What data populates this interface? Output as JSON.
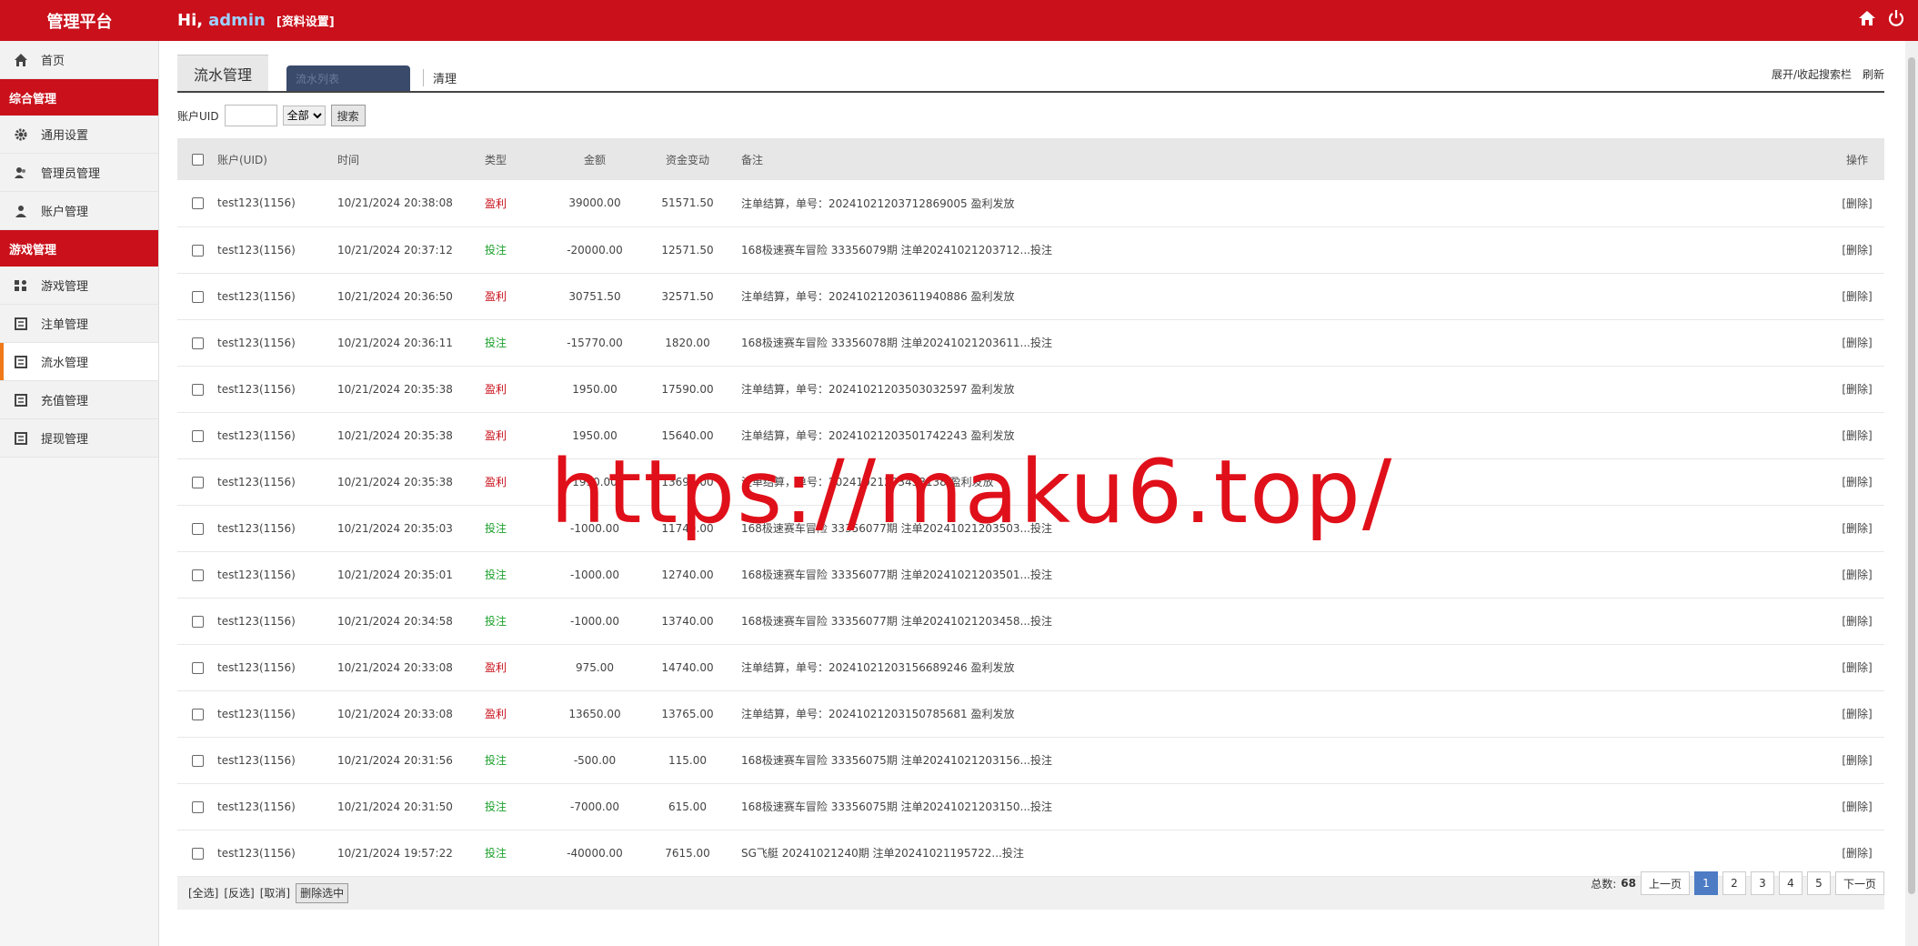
{
  "app": {
    "title": "管理平台",
    "greeting": "Hi,",
    "user": "admin",
    "profile_link": "[资料设置]"
  },
  "sidebar": {
    "home": "首页",
    "group1": "综合管理",
    "general_settings": "通用设置",
    "admin_manage": "管理员管理",
    "account_manage": "账户管理",
    "group2": "游戏管理",
    "game_manage": "游戏管理",
    "bet_manage": "注单管理",
    "flow_manage": "流水管理",
    "recharge_manage": "充值管理",
    "withdraw_manage": "提现管理"
  },
  "tabs": {
    "active": "流水管理",
    "input_placeholder": "流水列表",
    "clear": "清理",
    "toggle_search": "展开/收起搜索栏",
    "refresh": "刷新"
  },
  "search": {
    "label": "账户UID",
    "select_value": "全部",
    "button": "搜索"
  },
  "table": {
    "headers": {
      "account": "账户(UID)",
      "time": "时间",
      "type": "类型",
      "amount": "金额",
      "change": "资金变动",
      "note": "备注",
      "action": "操作"
    },
    "rows": [
      {
        "account": "test123(1156)",
        "time": "10/21/2024 20:38:08",
        "type": "盈利",
        "amount": "39000.00",
        "change": "51571.50",
        "note": "注单结算，单号：20241021203712869005 盈利发放",
        "action": "[删除]"
      },
      {
        "account": "test123(1156)",
        "time": "10/21/2024 20:37:12",
        "type": "投注",
        "amount": "-20000.00",
        "change": "12571.50",
        "note": "168极速赛车冒险 33356079期 注单20241021203712...投注",
        "action": "[删除]"
      },
      {
        "account": "test123(1156)",
        "time": "10/21/2024 20:36:50",
        "type": "盈利",
        "amount": "30751.50",
        "change": "32571.50",
        "note": "注单结算，单号：20241021203611940886 盈利发放",
        "action": "[删除]"
      },
      {
        "account": "test123(1156)",
        "time": "10/21/2024 20:36:11",
        "type": "投注",
        "amount": "-15770.00",
        "change": "1820.00",
        "note": "168极速赛车冒险 33356078期 注单20241021203611...投注",
        "action": "[删除]"
      },
      {
        "account": "test123(1156)",
        "time": "10/21/2024 20:35:38",
        "type": "盈利",
        "amount": "1950.00",
        "change": "17590.00",
        "note": "注单结算，单号：20241021203503032597 盈利发放",
        "action": "[删除]"
      },
      {
        "account": "test123(1156)",
        "time": "10/21/2024 20:35:38",
        "type": "盈利",
        "amount": "1950.00",
        "change": "15640.00",
        "note": "注单结算，单号：20241021203501742243 盈利发放",
        "action": "[删除]"
      },
      {
        "account": "test123(1156)",
        "time": "10/21/2024 20:35:38",
        "type": "盈利",
        "amount": "1950.00",
        "change": "13690.00",
        "note": "注单结算，单号：20241021203458138 盈利发放",
        "action": "[删除]"
      },
      {
        "account": "test123(1156)",
        "time": "10/21/2024 20:35:03",
        "type": "投注",
        "amount": "-1000.00",
        "change": "11740.00",
        "note": "168极速赛车冒险 33356077期 注单20241021203503...投注",
        "action": "[删除]"
      },
      {
        "account": "test123(1156)",
        "time": "10/21/2024 20:35:01",
        "type": "投注",
        "amount": "-1000.00",
        "change": "12740.00",
        "note": "168极速赛车冒险 33356077期 注单20241021203501...投注",
        "action": "[删除]"
      },
      {
        "account": "test123(1156)",
        "time": "10/21/2024 20:34:58",
        "type": "投注",
        "amount": "-1000.00",
        "change": "13740.00",
        "note": "168极速赛车冒险 33356077期 注单20241021203458...投注",
        "action": "[删除]"
      },
      {
        "account": "test123(1156)",
        "time": "10/21/2024 20:33:08",
        "type": "盈利",
        "amount": "975.00",
        "change": "14740.00",
        "note": "注单结算，单号：20241021203156689246 盈利发放",
        "action": "[删除]"
      },
      {
        "account": "test123(1156)",
        "time": "10/21/2024 20:33:08",
        "type": "盈利",
        "amount": "13650.00",
        "change": "13765.00",
        "note": "注单结算，单号：20241021203150785681 盈利发放",
        "action": "[删除]"
      },
      {
        "account": "test123(1156)",
        "time": "10/21/2024 20:31:56",
        "type": "投注",
        "amount": "-500.00",
        "change": "115.00",
        "note": "168极速赛车冒险 33356075期 注单20241021203156...投注",
        "action": "[删除]"
      },
      {
        "account": "test123(1156)",
        "time": "10/21/2024 20:31:50",
        "type": "投注",
        "amount": "-7000.00",
        "change": "615.00",
        "note": "168极速赛车冒险 33356075期 注单20241021203150...投注",
        "action": "[删除]"
      },
      {
        "account": "test123(1156)",
        "time": "10/21/2024 19:57:22",
        "type": "投注",
        "amount": "-40000.00",
        "change": "7615.00",
        "note": "SG飞艇 20241021240期 注单20241021195722...投注",
        "action": "[删除]"
      }
    ]
  },
  "footer": {
    "select_all": "[全选]",
    "invert": "[反选]",
    "cancel": "[取消]",
    "delete_selected": "删除选中"
  },
  "pager": {
    "total_label": "总数:",
    "total": "68",
    "prev": "上一页",
    "pages": [
      "1",
      "2",
      "3",
      "4",
      "5"
    ],
    "next": "下一页"
  },
  "watermark": "https://maku6.top/",
  "colors": {
    "brand": "#c9101b",
    "profit": "#c9101b",
    "bet": "#1a9f2a",
    "active_indicator": "#f07a1a"
  }
}
